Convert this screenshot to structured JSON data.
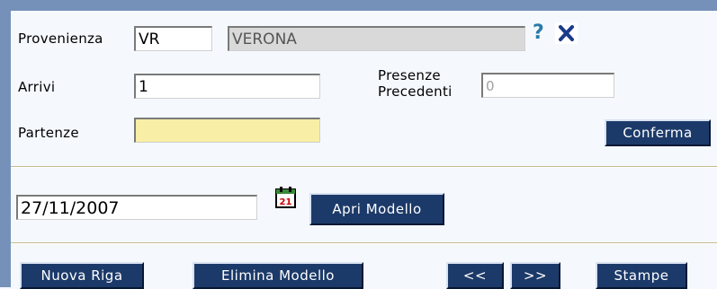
{
  "form": {
    "provenienza": {
      "label": "Provenienza",
      "code_value": "VR",
      "name_value": "VERONA",
      "help_glyph": "?",
      "help_icon": "question-mark-icon",
      "clear_icon": "close-x-icon"
    },
    "arrivi": {
      "label": "Arrivi",
      "value": "1"
    },
    "presenze_precedenti": {
      "label_line1": "Presenze",
      "label_line2": "Precedenti",
      "value": "0"
    },
    "partenze": {
      "label": "Partenze",
      "value": ""
    },
    "confirm_button": "Conferma"
  },
  "date_section": {
    "date_value": "27/11/2007",
    "calendar_icon": "calendar-icon",
    "calendar_day": "21",
    "open_model_button": "Apri Modello"
  },
  "bottom_toolbar": {
    "new_row_button": "Nuova Riga",
    "delete_model_button": "Elimina Modello",
    "prev_button": "<<",
    "next_button": ">>",
    "print_button": "Stampe"
  },
  "colors": {
    "frame_border": "#7591b9",
    "background": "#f5f9fe",
    "button_bg": "#1c3a69",
    "partenze_field_bg": "#f8eea6",
    "disabled_field_bg": "#d9d9d9",
    "help_icon_color": "#2a7ba8",
    "close_icon_color": "#1a3a8a",
    "separator": "#c9b98f"
  }
}
